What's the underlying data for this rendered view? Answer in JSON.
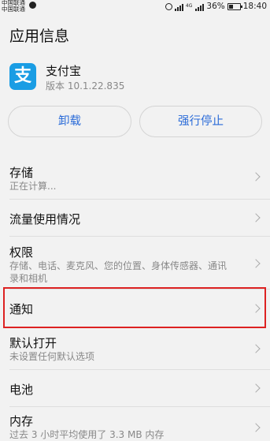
{
  "status_bar": {
    "carrier_1": "中国联通",
    "carrier_2": "中国联通",
    "network": "4G",
    "battery": "36%",
    "time": "18:40"
  },
  "page_title": "应用信息",
  "app": {
    "name": "支付宝",
    "version": "版本 10.1.22.835",
    "icon_glyph": "支",
    "icon_color": "#1a9de4"
  },
  "buttons": {
    "uninstall": "卸载",
    "force_stop": "强行停止",
    "accent_color": "#2a6bd8"
  },
  "settings": [
    {
      "title": "存储",
      "subtitle": "正在计算..."
    },
    {
      "title": "流量使用情况",
      "subtitle": ""
    },
    {
      "title": "权限",
      "subtitle_line1": "存储、电话、麦克风、您的位置、身体传感器、通讯",
      "subtitle_line2": "录和相机"
    },
    {
      "title": "通知",
      "subtitle": ""
    },
    {
      "title": "默认打开",
      "subtitle": "未设置任何默认选项"
    },
    {
      "title": "电池",
      "subtitle": ""
    },
    {
      "title": "内存",
      "subtitle": "过去 3 小时平均使用了 3.3 MB 内存"
    }
  ],
  "highlight_color": "#dd2222"
}
